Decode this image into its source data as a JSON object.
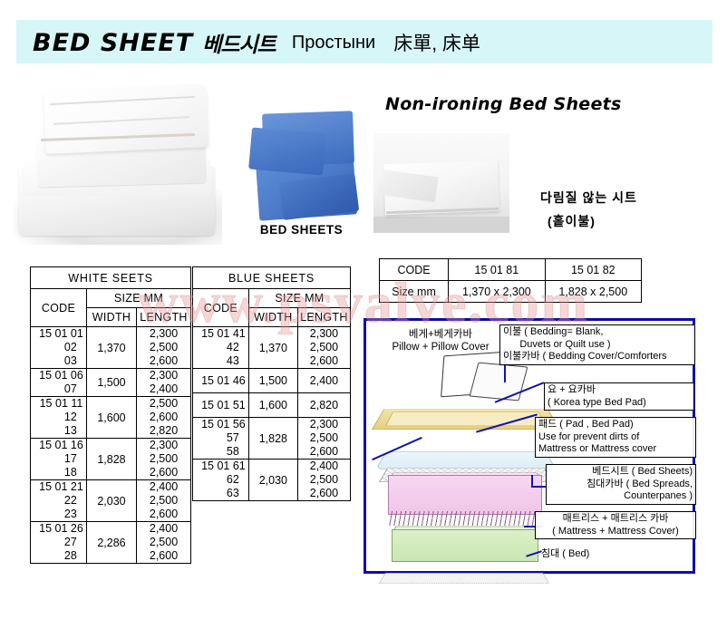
{
  "header": {
    "title_en": "BED SHEET",
    "title_kr": "베드시트",
    "title_ru": "Простыни",
    "title_cn": "床單, 床单",
    "band_color": "#d7f6f8"
  },
  "photos": {
    "white_sheets_alt": "stack of folded white bed sheets",
    "blue_sheets_alt": "stack of folded blue bed sheets",
    "blue_caption": "BED SHEETS",
    "non_ironing_alt": "folded white non-ironing bed sheet"
  },
  "non_ironing": {
    "title": "Non-ironing Bed Sheets",
    "kr_line1": "다림질 않는 시트",
    "kr_line2": "(홑이불)",
    "table": {
      "row_labels": [
        "CODE",
        "Size mm"
      ],
      "codes": [
        "15 01 81",
        "15 01 82"
      ],
      "sizes": [
        "1,370 x 2,300",
        "1,828 x 2,500"
      ]
    }
  },
  "white_table": {
    "title": "WHITE SEETS",
    "col_code": "CODE",
    "col_size": "SIZE MM",
    "col_width": "WIDTH",
    "col_length": "LENGTH",
    "rows": [
      {
        "code": "15 01 01\n      02\n      03",
        "width": "1,370",
        "length": "2,300\n2,500\n2,600"
      },
      {
        "code": "15 01 06\n      07",
        "width": "1,500",
        "length": "2,300\n2,400"
      },
      {
        "code": "15 01 11\n      12\n      13",
        "width": "1,600",
        "length": "2,500\n2,600\n2,820"
      },
      {
        "code": "15 01 16\n      17\n      18",
        "width": "1,828",
        "length": "2,300\n2,500\n2,600"
      },
      {
        "code": "15 01 21\n      22\n      23",
        "width": "2,030",
        "length": "2,400\n2,500\n2,600"
      },
      {
        "code": "15 01 26\n      27\n      28",
        "width": "2,286",
        "length": "2,400\n2,500\n2,600"
      }
    ]
  },
  "blue_table": {
    "title": "BLUE SHEETS",
    "col_code": "CODE",
    "col_size": "SIZE MM",
    "col_width": "WIDTH",
    "col_length": "LENGTH",
    "rows": [
      {
        "code": "15 01 41\n      42\n      43",
        "width": "1,370",
        "length": "2,300\n2,500\n2,600"
      },
      {
        "code": "15 01 46",
        "width": "1,500",
        "length": "2,400"
      },
      {
        "code": "15 01 51",
        "width": "1,600",
        "length": "2,820"
      },
      {
        "code": "15 01 56\n      57\n      58",
        "width": "1,828",
        "length": "2,300\n2,500\n2,600"
      },
      {
        "code": "15 01 61\n      62\n      63",
        "width": "2,030",
        "length": "2,400\n2,500\n2,600"
      }
    ]
  },
  "diagram": {
    "border_color": "#0b0bb5",
    "labels": {
      "pillow": "베게+베게카바\nPillow + Pillow Cover",
      "bedding": "이불 ( Bedding= Blank,\n      Duvets or Quilt use )\n이불카바 ( Bedding Cover/Comforters",
      "yo": "요 + 요카바\n( Korea type Bed Pad)",
      "pad": "패드 ( Pad , Bed Pad)\nUse for prevent dirts of\nMattress or Mattress cover",
      "bedsheet": "베드시트 ( Bed Sheets)\n침대카바 ( Bed Spreads,\n        Counterpanes )",
      "mattress": "매트리스 + 매트리스 카바\n( Mattress + Mattress Cover)",
      "bed": "침대 ( Bed)"
    }
  },
  "watermark": "www.psvalve.com"
}
